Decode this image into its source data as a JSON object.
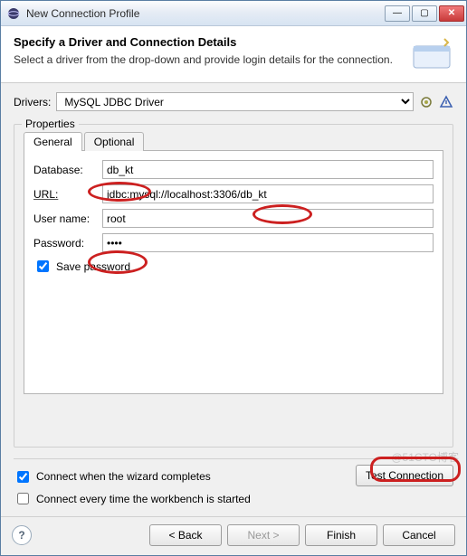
{
  "window": {
    "title": "New Connection Profile"
  },
  "header": {
    "title": "Specify a Driver and Connection Details",
    "subtitle": "Select a driver from the drop-down and provide login details for the connection."
  },
  "drivers": {
    "label": "Drivers:",
    "selected": "MySQL JDBC Driver"
  },
  "properties": {
    "legend": "Properties",
    "tabs": {
      "general": "General",
      "optional": "Optional"
    },
    "fields": {
      "database": {
        "label": "Database:",
        "value": "db_kt"
      },
      "url": {
        "label": "URL:",
        "value": "jdbc:mysql://localhost:3306/db_kt"
      },
      "username": {
        "label": "User name:",
        "value": "root"
      },
      "password": {
        "label": "Password:",
        "value": "••••"
      }
    },
    "save_password": {
      "label": "Save password",
      "checked": true
    }
  },
  "lower": {
    "connect_on_complete": {
      "label": "Connect when the wizard completes",
      "checked": true
    },
    "connect_on_start": {
      "label": "Connect every time the workbench is started",
      "checked": false
    },
    "test_button": "Test Connection"
  },
  "footer": {
    "back": "< Back",
    "next": "Next >",
    "finish": "Finish",
    "cancel": "Cancel"
  },
  "watermark": "@51CTO博客"
}
